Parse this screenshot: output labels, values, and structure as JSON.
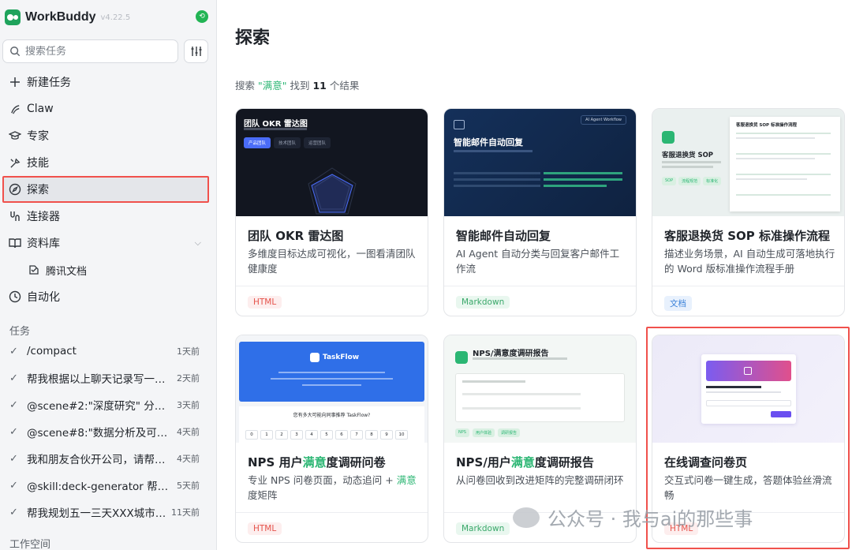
{
  "app": {
    "name": "WorkBuddy",
    "version": "v4.22.5"
  },
  "search": {
    "placeholder": "搜索任务"
  },
  "nav": [
    {
      "label": "新建任务",
      "icon": "plus-icon"
    },
    {
      "label": "Claw",
      "icon": "claw-icon"
    },
    {
      "label": "专家",
      "icon": "graduation-cap-icon"
    },
    {
      "label": "技能",
      "icon": "tools-icon"
    },
    {
      "label": "探索",
      "icon": "compass-icon",
      "active": true
    },
    {
      "label": "连接器",
      "icon": "connector-icon"
    },
    {
      "label": "资料库",
      "icon": "book-icon"
    },
    {
      "label": "腾讯文档",
      "icon": "tencent-docs-icon"
    },
    {
      "label": "自动化",
      "icon": "clock-icon"
    }
  ],
  "sections": {
    "tasks": "任务",
    "workspace": "工作空间"
  },
  "tasks": [
    {
      "title": "/compact",
      "time": "1天前"
    },
    {
      "title": "帮我根据以上聊天记录写一篇...",
      "time": "2天前"
    },
    {
      "title": "@scene#2:\"深度研究\" 分析 ...",
      "time": "3天前"
    },
    {
      "title": "@scene#8:\"数据分析及可视...",
      "time": "4天前"
    },
    {
      "title": "我和朋友合伙开公司，请帮我...",
      "time": "4天前"
    },
    {
      "title": "@skill:deck-generator 帮我...",
      "time": "5天前"
    },
    {
      "title": "帮我规划五一三天XXX城市行程",
      "time": "11天前"
    }
  ],
  "main": {
    "title": "探索",
    "result": {
      "prefix": "搜索",
      "query": "\"满意\"",
      "mid": "找到",
      "count": "11",
      "suffix": "个结果"
    }
  },
  "cards": [
    {
      "title": "团队 OKR 雷达图",
      "desc": "多维度目标达成可视化，一图看清团队健康度",
      "tag": "HTML",
      "thumb": {
        "heading": "团队 OKR 雷达图",
        "tabs": [
          "产品团队",
          "技术团队",
          "运营团队"
        ]
      }
    },
    {
      "title": "智能邮件自动回复",
      "desc": "AI Agent 自动分类与回复客户邮件工作流",
      "tag": "Markdown",
      "thumb": {
        "heading": "智能邮件自动回复",
        "label": "AI Agent Workflow"
      }
    },
    {
      "title": "客服退换货 SOP 标准操作流程",
      "desc": "描述业务场景，AI 自动生成可落地执行的 Word 版标准操作流程手册",
      "tag": "文档",
      "thumb": {
        "heading": "客服退换货 SOP",
        "doc_title": "客服退换货 SOP 标准操作流程",
        "chips": [
          "SOP",
          "流程规范",
          "标准化"
        ]
      }
    },
    {
      "title_pre": "NPS 用户",
      "title_hl": "满意",
      "title_post": "度调研问卷",
      "desc_pre": "专业 NPS 问卷页面，动态追问 + ",
      "desc_hl": "满意",
      "desc_post": "度矩阵",
      "tag": "HTML",
      "thumb": {
        "brand": "TaskFlow",
        "question": "您有多大可能向同事推荐 TaskFlow?",
        "scale": [
          "0",
          "1",
          "2",
          "3",
          "4",
          "5",
          "6",
          "7",
          "8",
          "9",
          "10"
        ]
      }
    },
    {
      "title_pre": "NPS/用户",
      "title_hl": "满意",
      "title_post": "度调研报告",
      "desc": "从问卷回收到改进矩阵的完整调研闭环",
      "tag": "Markdown",
      "thumb": {
        "heading": "NPS/满意度调研报告",
        "chips": [
          "NPS",
          "用户体验",
          "调研报告"
        ]
      }
    },
    {
      "title": "在线调查问卷页",
      "desc": "交互式问卷一键生成，答题体验丝滑流畅",
      "tag": "HTML",
      "thumb": {}
    }
  ],
  "watermark": "公众号 · 我与ai的那些事",
  "colors": {
    "accent": "#2bb673",
    "highlight": "#f0514c"
  }
}
